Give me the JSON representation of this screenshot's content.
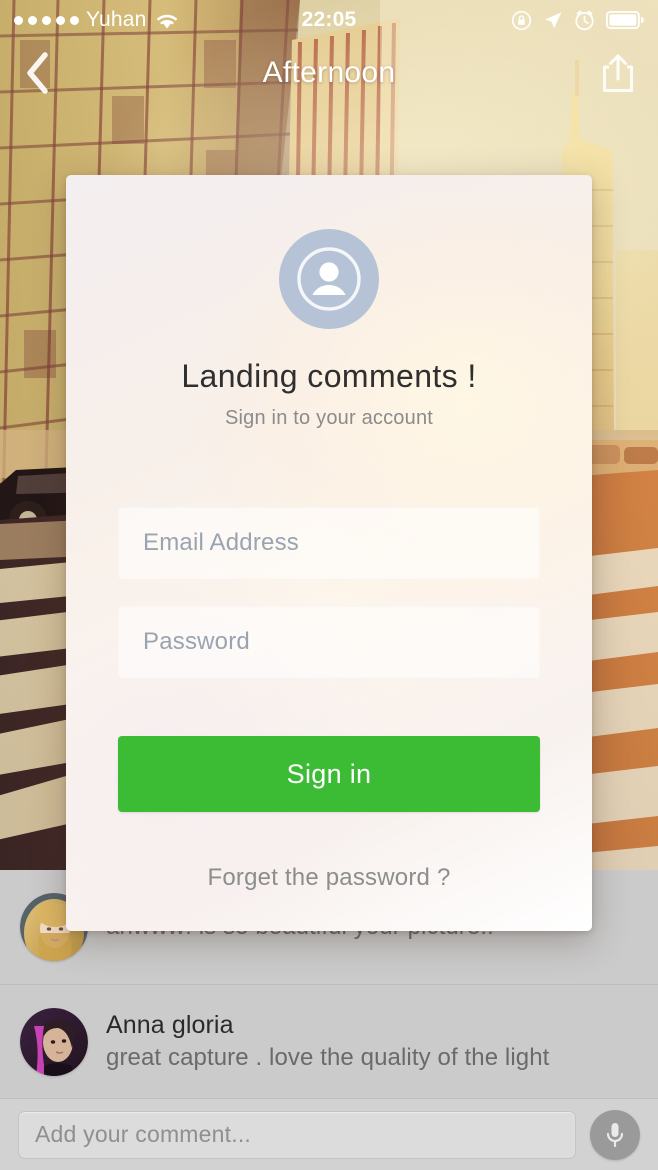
{
  "status_bar": {
    "signal_dots": 5,
    "carrier": "Yuhan",
    "wifi_icon": "wifi-icon",
    "time": "22:05",
    "rotation_lock_icon": "rotation-lock-icon",
    "location_icon": "location-arrow-icon",
    "alarm_icon": "alarm-clock-icon",
    "battery_icon": "battery-icon"
  },
  "nav": {
    "back_icon": "chevron-left-icon",
    "title": "Afternoon",
    "share_icon": "share-icon"
  },
  "modal": {
    "avatar_icon": "user-avatar-icon",
    "title": "Landing comments !",
    "subtitle": "Sign in to your account",
    "email": {
      "value": "",
      "placeholder": "Email  Address"
    },
    "password": {
      "value": "",
      "placeholder": "Password"
    },
    "signin_label": "Sign in",
    "forgot_label": "Forget the password ?",
    "accent_color": "#3bbc34"
  },
  "comments": [
    {
      "avatar": "avatar-blonde-woman",
      "name": "",
      "text": "ahwww! is so beautiful your picture!!"
    },
    {
      "avatar": "avatar-anna-gloria",
      "name": "Anna gloria",
      "text": "great capture . love the quality of the light"
    }
  ],
  "composer": {
    "placeholder": "Add your comment...",
    "value": "",
    "mic_icon": "microphone-icon"
  },
  "colors": {
    "accent_green": "#3bbc34",
    "list_background": "#cbcbcb",
    "composer_background": "#d2d2d2",
    "avatar_circle": "#b6c3d6"
  }
}
